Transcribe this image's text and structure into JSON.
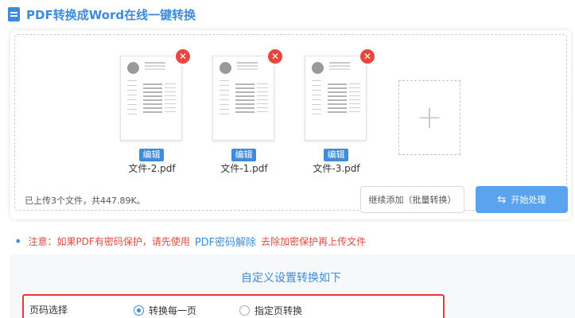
{
  "header": {
    "title": "PDF转换成Word在线一键转换",
    "icon": "document-icon"
  },
  "files": [
    {
      "name": "文件-2.pdf",
      "edit_label": "编辑",
      "close_symbol": "✕"
    },
    {
      "name": "文件-1.pdf",
      "edit_label": "编辑",
      "close_symbol": "✕"
    },
    {
      "name": "文件-3.pdf",
      "edit_label": "编辑",
      "close_symbol": "✕"
    }
  ],
  "add_tile": {
    "symbol": "+"
  },
  "summary": "已上传3个文件，共447.89K。",
  "buttons": {
    "continue_label": "继续添加（批量转换）",
    "start_label": "开始处理",
    "start_icon": "⇆"
  },
  "notice": {
    "bullet": "•",
    "prefix": "注意：如果PDF有密码保护，请先使用",
    "link": "PDF密码解除",
    "suffix": "去除加密保护再上传文件"
  },
  "settings": {
    "title": "自定义设置转换如下",
    "page_select_label": "页码选择",
    "options": [
      {
        "label": "转换每一页",
        "checked": true
      },
      {
        "label": "指定页转换",
        "checked": false
      }
    ]
  },
  "colors": {
    "accent": "#3d8bdc",
    "danger": "#e8453c",
    "primary_button": "#5aa3ee",
    "notice": "#e04a3c"
  }
}
